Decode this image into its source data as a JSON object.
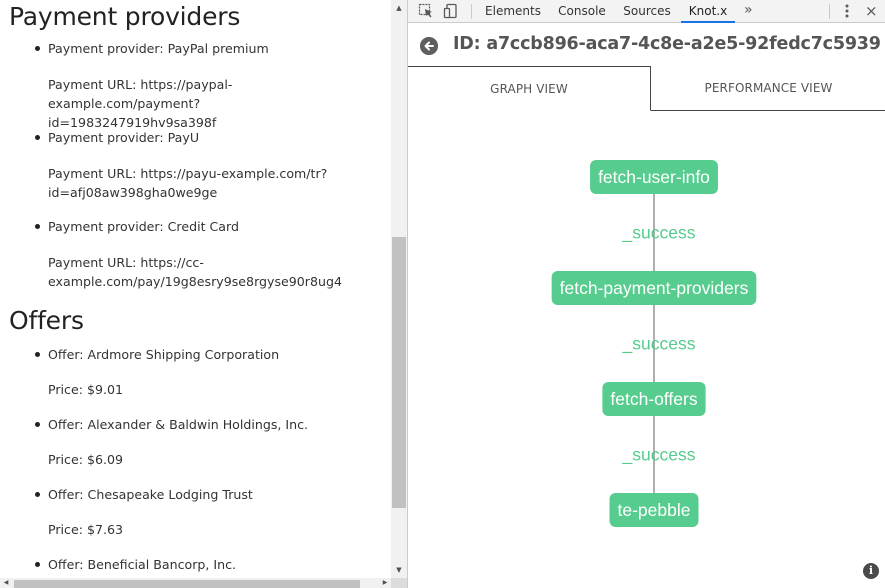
{
  "page": {
    "sections": [
      {
        "heading": "Payment providers",
        "items": [
          {
            "label": "Payment provider: PayPal premium",
            "detail": "Payment URL: https://paypal-example.com/payment?\nid=1983247919hv9sa398f"
          },
          {
            "label": "Payment provider: PayU",
            "detail": "Payment URL: https://payu-example.com/tr?\nid=afj08aw398gha0we9ge"
          },
          {
            "label": "Payment provider: Credit Card",
            "detail": "Payment URL: https://cc-\nexample.com/pay/19g8esry9se8rgyse90r8ug4"
          }
        ]
      },
      {
        "heading": "Offers",
        "items": [
          {
            "label": "Offer: Ardmore Shipping Corporation",
            "detail": "Price: $9.01"
          },
          {
            "label": "Offer: Alexander & Baldwin Holdings, Inc.",
            "detail": "Price: $6.09"
          },
          {
            "label": "Offer: Chesapeake Lodging Trust",
            "detail": "Price: $7.63"
          },
          {
            "label": "Offer: Beneficial Bancorp, Inc.",
            "detail": ""
          }
        ]
      }
    ]
  },
  "devtools": {
    "tabs": [
      {
        "label": "Elements",
        "active": false
      },
      {
        "label": "Console",
        "active": false
      },
      {
        "label": "Sources",
        "active": false
      },
      {
        "label": "Knot.x",
        "active": true
      }
    ],
    "more_label": "»",
    "close_label": "×",
    "icons": [
      "inspect-element-icon",
      "device-toolbar-icon",
      "kebab-menu-icon",
      "close-icon"
    ]
  },
  "knotx": {
    "id_text": "ID: a7ccb896-aca7-4c8e-a2e5-92fedc7c5939",
    "view_tabs": {
      "graph": "GRAPH VIEW",
      "performance": "PERFORMANCE VIEW"
    },
    "active_view": "graph",
    "graph": {
      "nodes": [
        "fetch-user-info",
        "fetch-payment-providers",
        "fetch-offers",
        "te-pebble"
      ],
      "edges": [
        "_success",
        "_success",
        "_success"
      ],
      "node_color": "#56cc8e",
      "edge_label_color": "#56cc8e",
      "edge_line_color": "#7a7a7a"
    },
    "info_icon": "i"
  }
}
